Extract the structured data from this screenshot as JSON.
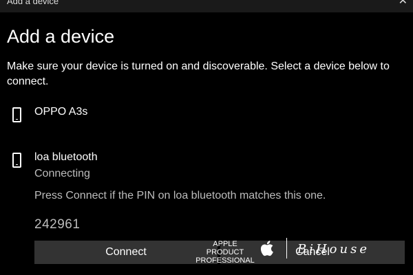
{
  "window": {
    "title": "Add a device",
    "close_glyph": "✕"
  },
  "dialog": {
    "heading": "Add a device",
    "instruction": "Make sure your device is turned on and discoverable. Select a device below to connect."
  },
  "devices": [
    {
      "name": "OPPO A3s",
      "status": "",
      "icon": "phone-icon"
    },
    {
      "name": "loa bluetooth",
      "status": "Connecting",
      "icon": "phone-icon"
    }
  ],
  "pairing": {
    "prompt": "Press Connect if the PIN on loa bluetooth matches this one.",
    "pin": "242961"
  },
  "buttons": {
    "connect": "Connect",
    "cancel": "Cancel"
  },
  "watermark": {
    "line1": "APPLE PRODUCT",
    "line2": "PROFESSIONAL",
    "logo": "apple-logo",
    "signature": "BiHouse"
  },
  "colors": {
    "background": "#000000",
    "button": "#333333",
    "secondary_text": "#bdbdbd"
  }
}
